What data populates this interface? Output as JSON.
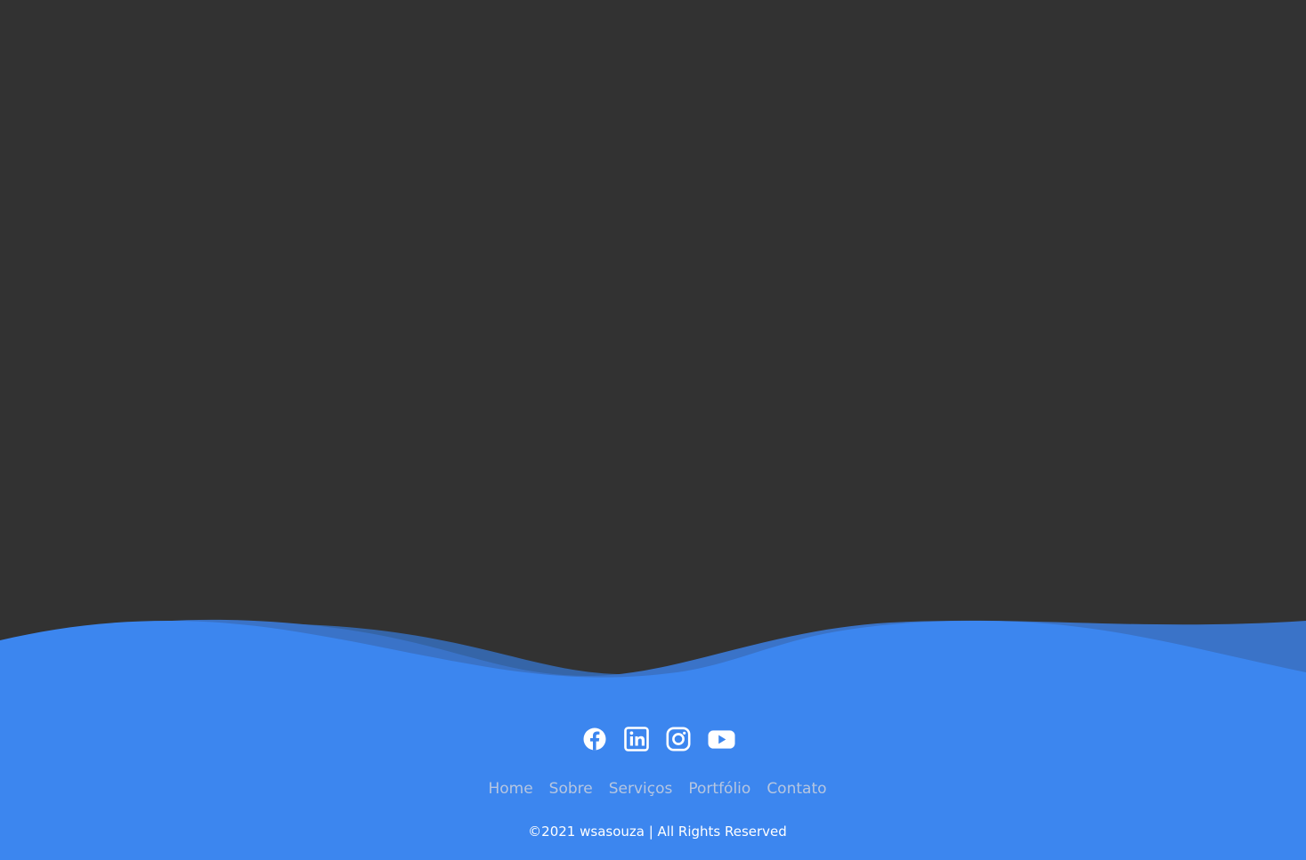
{
  "colors": {
    "background": "#323232",
    "footer_blue": "#3c86ef",
    "wave_dark": "#3565a8",
    "wave_mid": "#3a73c8",
    "nav_text": "#b6c6e0",
    "copyright_text": "#ffffff"
  },
  "social_icons": [
    {
      "name": "facebook-icon"
    },
    {
      "name": "linkedin-icon"
    },
    {
      "name": "instagram-icon"
    },
    {
      "name": "youtube-icon"
    }
  ],
  "nav": {
    "items": [
      {
        "label": "Home"
      },
      {
        "label": "Sobre"
      },
      {
        "label": "Serviços"
      },
      {
        "label": "Portfólio"
      },
      {
        "label": "Contato"
      }
    ]
  },
  "footer": {
    "copyright": "©2021 wsasouza | All Rights Reserved"
  }
}
